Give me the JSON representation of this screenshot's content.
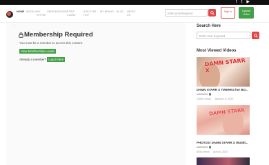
{
  "social": {
    "icons": [
      "facebook-icon",
      "twitter-icon",
      "youtube-icon"
    ],
    "glyphs": [
      "f",
      "t",
      "▶"
    ]
  },
  "nav": {
    "items": [
      {
        "label": "HOME",
        "active": true
      },
      {
        "label": "MODELS"
      },
      {
        "label": "MY OFFICE"
      },
      {
        "label": "UNDERGROUND"
      },
      {
        "label": "STRIP CLUBS"
      },
      {
        "label": "SUB STAR HOP"
      },
      {
        "label": "MY BRAND"
      },
      {
        "label": "BLOG"
      },
      {
        "label": "ABOUT US"
      }
    ]
  },
  "header": {
    "search_placeholder": "Enter your keyword",
    "signin_label": "Sign in",
    "upload_label": "Upload Video"
  },
  "main": {
    "breadcrumb": "~",
    "title": "Membership Required",
    "message": "You must be a member to access this content.",
    "levels_button": "View Membership Levels",
    "already_text": "Already a member?",
    "login_button": "Log in here"
  },
  "sidebar": {
    "search_heading": "Search Here",
    "search_placeholder": "Enter Your Keyword",
    "most_viewed_heading": "Most Viewed Videos",
    "videos": [
      {
        "title": "DAMN STARR X TWERKS her BO...",
        "overlay": "DAMN STARR X",
        "user": "subboard",
        "views": "13836 views",
        "date": "January 8, 2020"
      },
      {
        "title": "PHOTOS! DAMN STARR X Wobbl...",
        "overlay": "DAMN STARR",
        "user": "subboard",
        "views": "8356 views",
        "date": "April 8, 2020"
      }
    ]
  },
  "colors": {
    "accent_red": "#e04646",
    "accent_green": "#43a047",
    "topbar": "#101010"
  }
}
